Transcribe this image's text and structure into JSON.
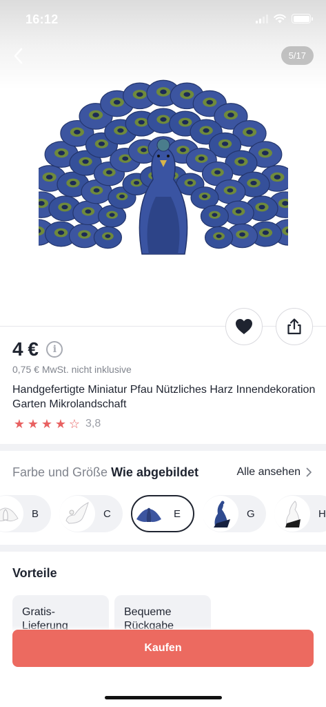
{
  "status_bar": {
    "time": "16:12"
  },
  "gallery": {
    "counter": "5/17"
  },
  "product": {
    "price": "4 €",
    "vat_note": "0,75 € MwSt. nicht inklusive",
    "title": "Handgefertigte Miniatur Pfau Nützliches Harz Innendekoration Garten Mikrolandschaft",
    "rating_value": "3,8",
    "stars": [
      "★",
      "★",
      "★",
      "★",
      "☆"
    ]
  },
  "variants": {
    "heading_prefix": "Farbe und Größe",
    "heading_selected": "Wie abgebildet",
    "see_all": "Alle ansehen",
    "items": [
      {
        "label": "B",
        "color": "#ffffff"
      },
      {
        "label": "C",
        "color": "#ffffff"
      },
      {
        "label": "E",
        "color": "#3c55a0",
        "selected": true
      },
      {
        "label": "G",
        "color": "#2f4a8f"
      },
      {
        "label": "H",
        "color": "#ffffff"
      }
    ]
  },
  "benefits": {
    "title": "Vorteile",
    "items": [
      {
        "text": "Gratis-Lieferung"
      },
      {
        "text": "Bequeme Rückgabe"
      }
    ]
  },
  "cta": {
    "buy_label": "Kaufen"
  },
  "colors": {
    "accent": "#ec6a60",
    "star": "#e86161",
    "peacock_blue": "#3c55a0",
    "text_primary": "#1f2430",
    "text_secondary": "#80848d"
  },
  "icons": {
    "back": "chevron-left-icon",
    "favorite": "heart-icon",
    "share": "share-icon",
    "info": "info-icon",
    "see_all": "chevron-right-icon"
  }
}
